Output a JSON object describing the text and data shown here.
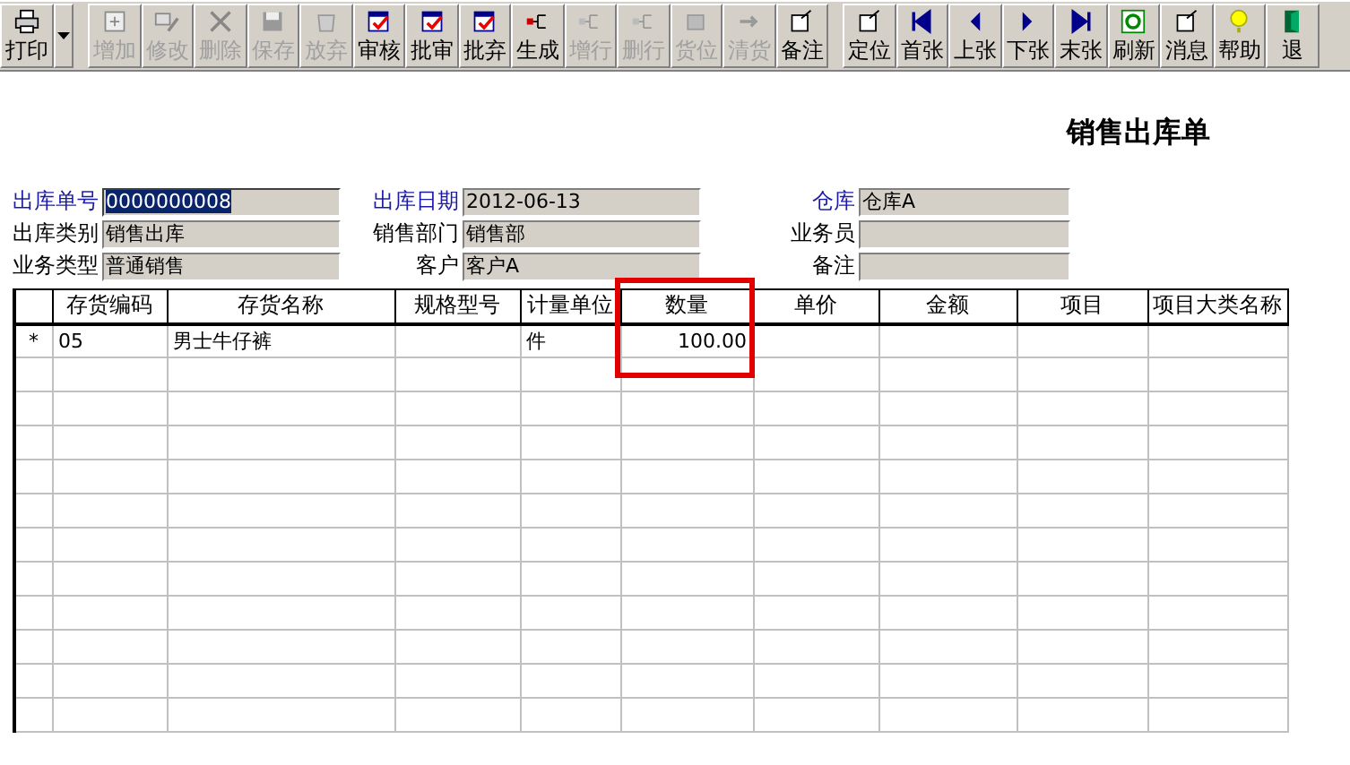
{
  "toolbar": [
    {
      "label": "打印",
      "disabled": false,
      "dropdown": true,
      "group_end": true
    },
    {
      "label": "增加",
      "disabled": true
    },
    {
      "label": "修改",
      "disabled": true
    },
    {
      "label": "删除",
      "disabled": true
    },
    {
      "label": "保存",
      "disabled": true
    },
    {
      "label": "放弃",
      "disabled": true
    },
    {
      "label": "审核",
      "disabled": false
    },
    {
      "label": "批审",
      "disabled": false
    },
    {
      "label": "批弃",
      "disabled": false
    },
    {
      "label": "生成",
      "disabled": false
    },
    {
      "label": "增行",
      "disabled": true
    },
    {
      "label": "删行",
      "disabled": true
    },
    {
      "label": "货位",
      "disabled": true
    },
    {
      "label": "清货",
      "disabled": true
    },
    {
      "label": "备注",
      "disabled": false,
      "group_end": true
    },
    {
      "label": "定位",
      "disabled": false
    },
    {
      "label": "首张",
      "disabled": false
    },
    {
      "label": "上张",
      "disabled": false
    },
    {
      "label": "下张",
      "disabled": false
    },
    {
      "label": "末张",
      "disabled": false
    },
    {
      "label": "刷新",
      "disabled": false
    },
    {
      "label": "消息",
      "disabled": false
    },
    {
      "label": "帮助",
      "disabled": false
    },
    {
      "label": "退",
      "disabled": false
    }
  ],
  "title": "销售出库单",
  "fields": [
    {
      "label": "出库单号",
      "value": "0000000008",
      "required": true,
      "selected": true
    },
    {
      "label": "出库日期",
      "value": "2012-06-13",
      "required": true,
      "selected": false
    },
    {
      "label": "仓库",
      "value": "仓库A",
      "required": true,
      "selected": false
    },
    {
      "label": "出库类别",
      "value": "销售出库",
      "required": false,
      "selected": false
    },
    {
      "label": "销售部门",
      "value": "销售部",
      "required": false,
      "selected": false
    },
    {
      "label": "业务员",
      "required": false,
      "selected": false
    },
    {
      "label": "业务类型",
      "value": "普通销售",
      "required": false,
      "selected": false
    },
    {
      "label": "客户",
      "value": "客户A",
      "required": false,
      "selected": false
    },
    {
      "label": "备注",
      "required": false,
      "selected": false
    }
  ],
  "table": {
    "columns": [
      {
        "label": "存货编码",
        "highlighted": false
      },
      {
        "label": "存货名称",
        "highlighted": false
      },
      {
        "label": "规格型号",
        "highlighted": false
      },
      {
        "label": "计量单位",
        "highlighted": false
      },
      {
        "label": "数量",
        "highlighted": true
      },
      {
        "label": "单价",
        "highlighted": false
      },
      {
        "label": "金额",
        "highlighted": false
      },
      {
        "label": "项目",
        "highlighted": false
      },
      {
        "label": "项目大类名称",
        "highlighted": false
      }
    ],
    "rows": [
      {
        "marker": "*",
        "cells": {
          "0": "05",
          "1": "男士牛仔裤",
          "3": "件",
          "4": "100.00"
        }
      }
    ]
  }
}
